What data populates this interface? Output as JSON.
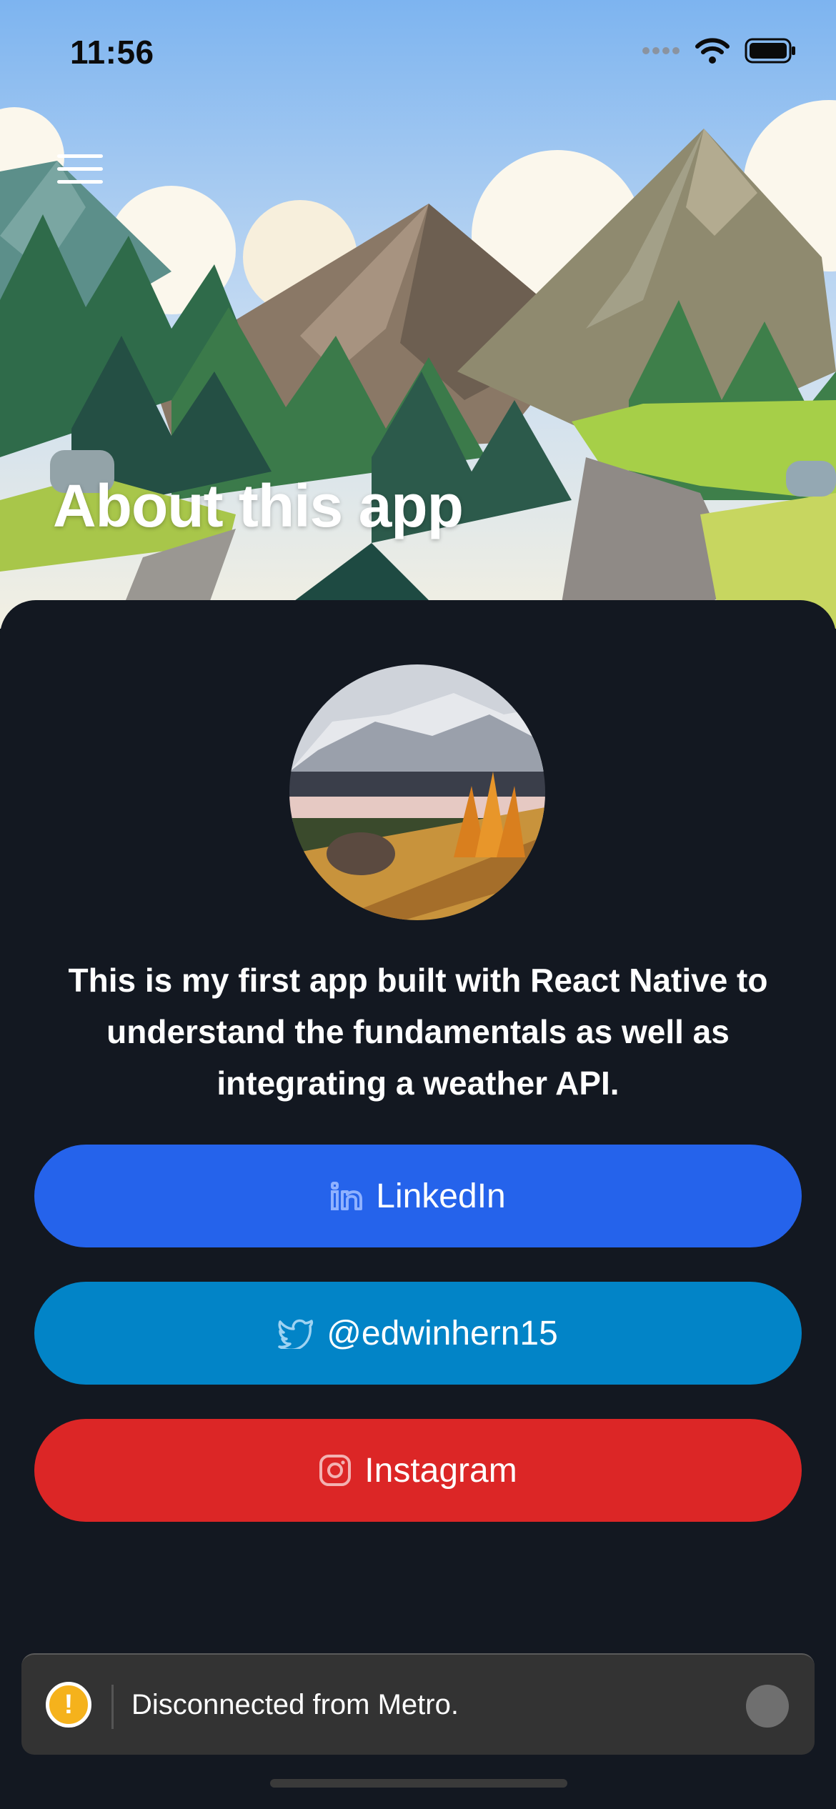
{
  "status_bar": {
    "time": "11:56",
    "icons": [
      "signal-dots-icon",
      "wifi-icon",
      "battery-icon"
    ]
  },
  "header": {
    "menu_icon": "hamburger-menu-icon",
    "title": "About this app"
  },
  "about": {
    "description": "This is my first app built with React Native to understand the fundamentals as well as integrating a weather API."
  },
  "buttons": {
    "linkedin": {
      "label": "LinkedIn",
      "icon": "linkedin-icon",
      "color": "#2563eb"
    },
    "twitter": {
      "label": "@edwinhern15",
      "icon": "twitter-icon",
      "color": "#0284c7"
    },
    "instagram": {
      "label": "Instagram",
      "icon": "instagram-icon",
      "color": "#dc2626"
    }
  },
  "toast": {
    "icon_glyph": "!",
    "message": "Disconnected from Metro.",
    "accent": "#f5b21c"
  },
  "colors": {
    "background": "#131821",
    "sky": "#7fb6ef"
  }
}
